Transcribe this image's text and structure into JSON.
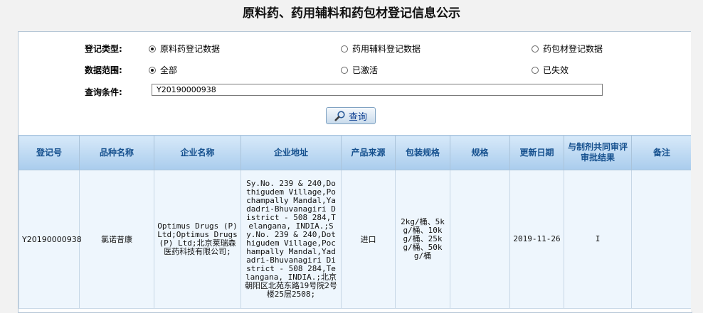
{
  "page": {
    "title": "原料药、药用辅料和药包材登记信息公示"
  },
  "filters": {
    "reg_type": {
      "label": "登记类型:",
      "options": [
        {
          "label": "原料药登记数据",
          "checked": true
        },
        {
          "label": "药用辅料登记数据",
          "checked": false
        },
        {
          "label": "药包材登记数据",
          "checked": false
        }
      ]
    },
    "data_scope": {
      "label": "数据范围:",
      "options": [
        {
          "label": "全部",
          "checked": true
        },
        {
          "label": "已激活",
          "checked": false
        },
        {
          "label": "已失效",
          "checked": false
        }
      ]
    },
    "query": {
      "label": "查询条件:",
      "value": "Y20190000938"
    }
  },
  "search_button": {
    "label": "查询",
    "icon": "magnifier-icon"
  },
  "table": {
    "headers": [
      "登记号",
      "品种名称",
      "企业名称",
      "企业地址",
      "产品来源",
      "包装规格",
      "规格",
      "更新日期",
      "与制剂共同审评审批结果",
      "备注"
    ],
    "rows": [
      {
        "reg_no": "Y20190000938",
        "product": "氯诺昔康",
        "company": "Optimus Drugs (P) Ltd;Optimus Drugs (P) Ltd;北京莱瑞森医药科技有限公司;",
        "address": "Sy.No. 239 & 240,Dothigudem Village,Pochampally Mandal,Yadadri-Bhuvanagiri District - 508 284,Telangana, INDIA.;Sy.No. 239 & 240,Dothigudem Village,Pochampally Mandal,Yadadri-Bhuvanagiri District - 508 284,Telangana, INDIA.;北京朝阳区北苑东路19号院2号楼25层2508;",
        "source": "进口",
        "packaging": "2kg/桶、5kg/桶、10kg/桶、25kg/桶、50kg/桶",
        "spec": "",
        "updated": "2019-11-26",
        "review_result": "I",
        "remark": ""
      }
    ]
  }
}
